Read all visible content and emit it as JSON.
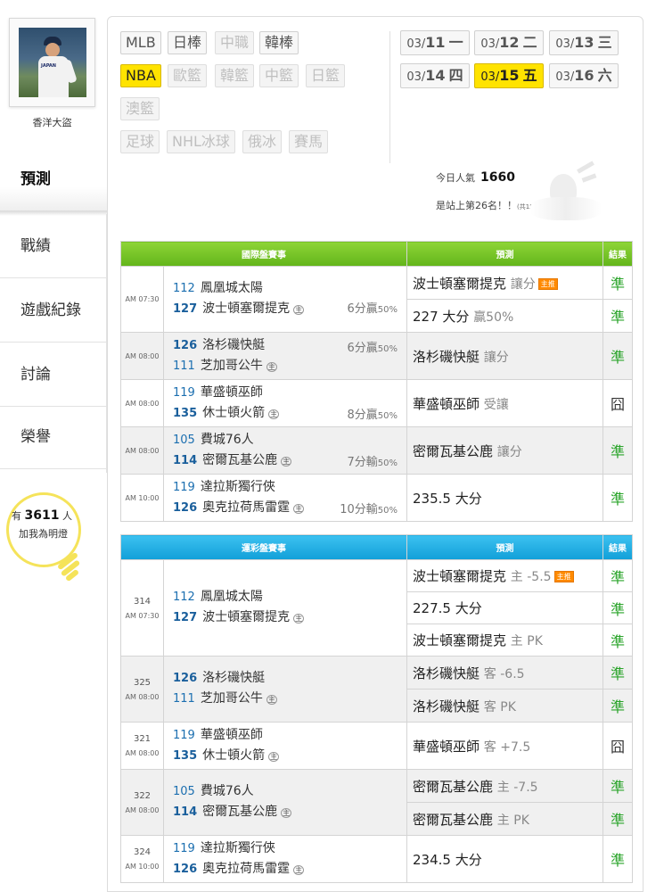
{
  "user": {
    "name": "香洋大盜",
    "avatar_text": "JAPAN"
  },
  "nav": {
    "predict": "預測",
    "record": "戰績",
    "history": "遊戲紀錄",
    "discuss": "討論",
    "honor": "榮譽"
  },
  "fans": {
    "prefix": "有",
    "count": "3611",
    "suffix": "人",
    "line2": "加我為明燈"
  },
  "leagues": {
    "mlb": "MLB",
    "npb": "日棒",
    "cpbl": "中職",
    "kbo": "韓棒",
    "nba": "NBA",
    "euro": "歐籃",
    "kbl": "韓籃",
    "cba": "中籃",
    "bj": "日籃",
    "nbl": "澳籃",
    "soccer": "足球",
    "nhl": "NHL冰球",
    "khl": "俄冰",
    "horse": "賽馬"
  },
  "dates": [
    {
      "month": "03/",
      "day": "11",
      "weekday": "一"
    },
    {
      "month": "03/",
      "day": "12",
      "weekday": "二"
    },
    {
      "month": "03/",
      "day": "13",
      "weekday": "三"
    },
    {
      "month": "03/",
      "day": "14",
      "weekday": "四"
    },
    {
      "month": "03/",
      "day": "15",
      "weekday": "五"
    },
    {
      "month": "03/",
      "day": "16",
      "weekday": "六"
    }
  ],
  "popularity": {
    "label": "今日人氣",
    "value": "1660",
    "rank": "是站上第26名！！",
    "total": "(共15496人)"
  },
  "intl": {
    "header": {
      "games": "國際盤賽事",
      "predict": "預測",
      "result": "結果"
    },
    "games": [
      {
        "time": "AM 07:30",
        "away_num": "112",
        "away": "鳳凰城太陽",
        "home_num": "127",
        "home": "波士頓塞爾提克",
        "home_mark": "主",
        "handicap": "6分贏",
        "handicap_pct": "50%",
        "p1_team": "波士頓塞爾提克",
        "p1_type": "讓分",
        "p1_badge": "主推",
        "r1": "準",
        "p2_team": "227 大分",
        "p2_type": "贏50%",
        "r2": "準"
      },
      {
        "time": "AM 08:00",
        "away_num": "126",
        "away": "洛杉磯快艇",
        "home_num": "111",
        "home": "芝加哥公牛",
        "home_mark": "主",
        "handicap": "6分贏",
        "handicap_pct": "50%",
        "p1_team": "洛杉磯快艇",
        "p1_type": "讓分",
        "r1": "準"
      },
      {
        "time": "AM 08:00",
        "away_num": "119",
        "away": "華盛頓巫師",
        "home_num": "135",
        "home": "休士頓火箭",
        "home_mark": "主",
        "handicap": "8分贏",
        "handicap_pct": "50%",
        "p1_team": "華盛頓巫師",
        "p1_type": "受讓",
        "r1": "囧"
      },
      {
        "time": "AM 08:00",
        "away_num": "105",
        "away": "費城76人",
        "home_num": "114",
        "home": "密爾瓦基公鹿",
        "home_mark": "主",
        "handicap": "7分輸",
        "handicap_pct": "50%",
        "p1_team": "密爾瓦基公鹿",
        "p1_type": "讓分",
        "r1": "準"
      },
      {
        "time": "AM 10:00",
        "away_num": "119",
        "away": "達拉斯獨行俠",
        "home_num": "126",
        "home": "奧克拉荷馬雷霆",
        "home_mark": "主",
        "handicap": "10分輸",
        "handicap_pct": "50%",
        "p1_team": "235.5 大分",
        "p1_type": "",
        "r1": "準"
      }
    ]
  },
  "lottery": {
    "header": {
      "games": "運彩盤賽事",
      "predict": "預測",
      "result": "結果"
    },
    "games": [
      {
        "code": "314",
        "time": "AM 07:30",
        "away_num": "112",
        "away": "鳳凰城太陽",
        "home_num": "127",
        "home": "波士頓塞爾提克",
        "home_mark": "主",
        "p1_team": "波士頓塞爾提克",
        "p1_type": "主 -5.5",
        "p1_badge": "主推",
        "r1": "準",
        "p2_team": "227.5 大分",
        "r2": "準",
        "p3_team": "波士頓塞爾提克",
        "p3_type": "主 PK",
        "r3": "準"
      },
      {
        "code": "325",
        "time": "AM 08:00",
        "away_num": "126",
        "away": "洛杉磯快艇",
        "home_num": "111",
        "home": "芝加哥公牛",
        "home_mark": "主",
        "p1_team": "洛杉磯快艇",
        "p1_type": "客 -6.5",
        "r1": "準",
        "p2_team": "洛杉磯快艇",
        "p2_type": "客 PK",
        "r2": "準"
      },
      {
        "code": "321",
        "time": "AM 08:00",
        "away_num": "119",
        "away": "華盛頓巫師",
        "home_num": "135",
        "home": "休士頓火箭",
        "home_mark": "主",
        "p1_team": "華盛頓巫師",
        "p1_type": "客 +7.5",
        "r1": "囧"
      },
      {
        "code": "322",
        "time": "AM 08:00",
        "away_num": "105",
        "away": "費城76人",
        "home_num": "114",
        "home": "密爾瓦基公鹿",
        "home_mark": "主",
        "p1_team": "密爾瓦基公鹿",
        "p1_type": "主 -7.5",
        "r1": "準",
        "p2_team": "密爾瓦基公鹿",
        "p2_type": "主 PK",
        "r2": "準"
      },
      {
        "code": "324",
        "time": "AM 10:00",
        "away_num": "119",
        "away": "達拉斯獨行俠",
        "home_num": "126",
        "home": "奧克拉荷馬雷霆",
        "home_mark": "主",
        "p1_team": "234.5 大分",
        "r1": "準"
      }
    ]
  }
}
